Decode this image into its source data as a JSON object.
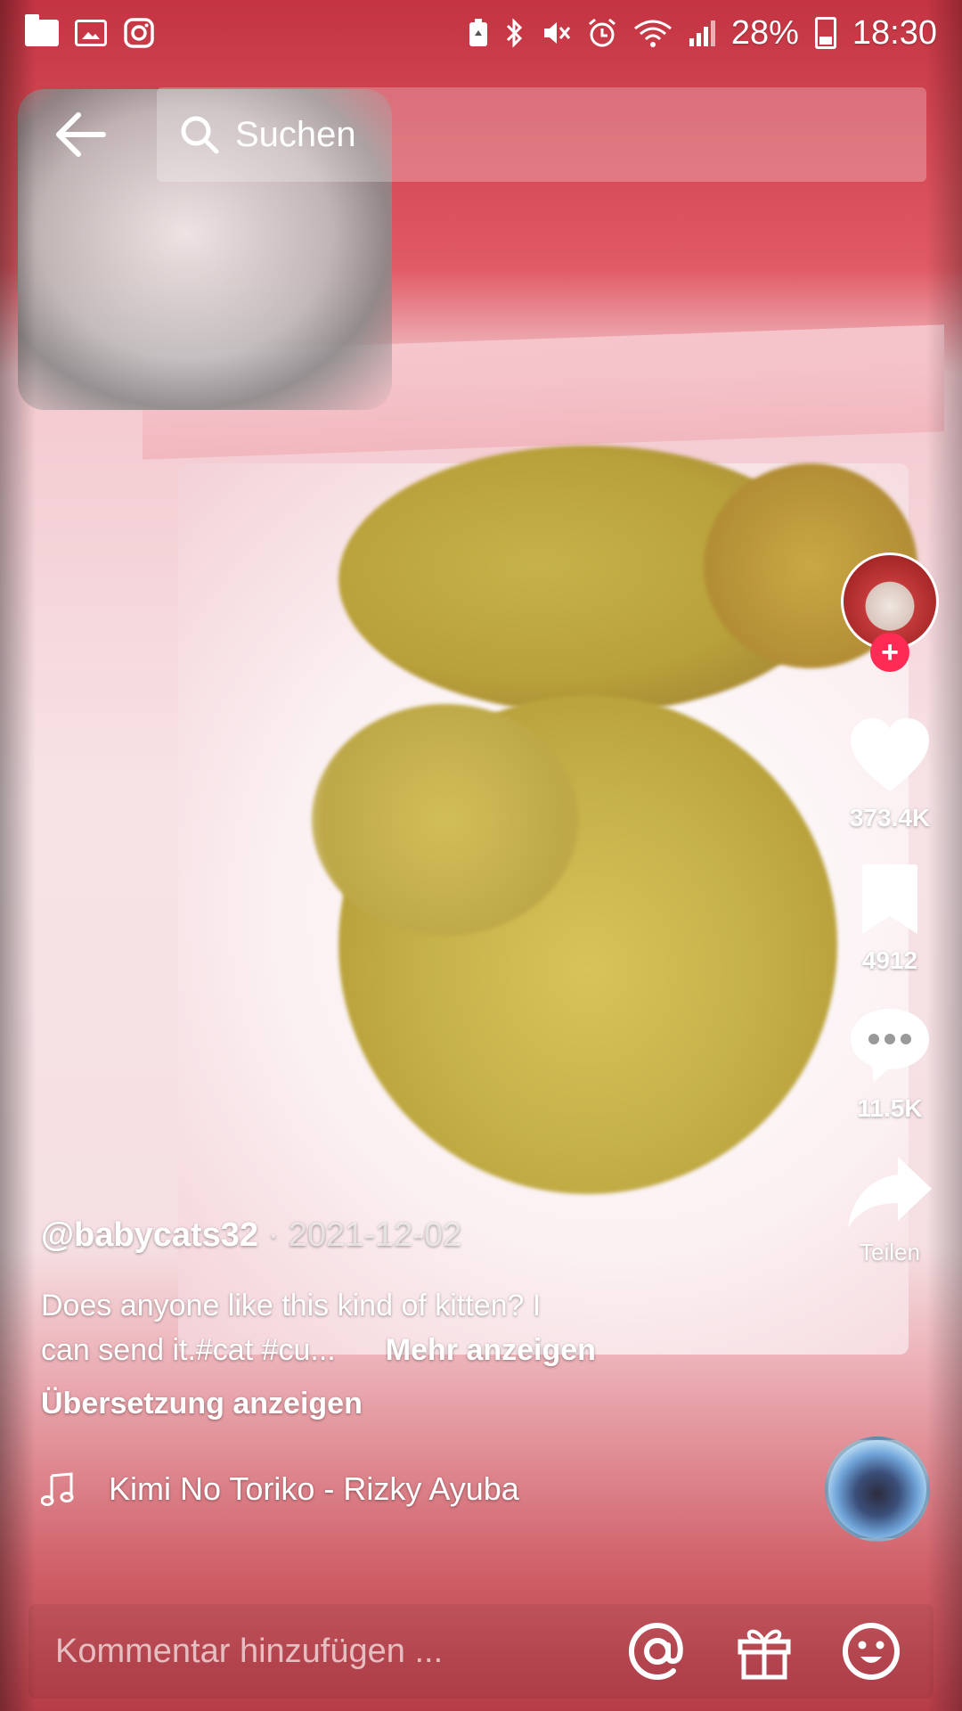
{
  "status_bar": {
    "battery": "28%",
    "time": "18:30",
    "left_icons": [
      "folder-icon",
      "gallery-icon",
      "instagram-icon"
    ],
    "right_icons": [
      "battery-saver-icon",
      "bluetooth-icon",
      "mute-icon",
      "alarm-icon",
      "wifi-icon",
      "signal-icon",
      "battery-icon"
    ]
  },
  "top_bar": {
    "back_icon": "arrow-left-icon",
    "search_icon": "search-icon",
    "search_label": "Suchen"
  },
  "actions": {
    "follow_icon": "plus-icon",
    "like_count": "373.4K",
    "save_count": "4912",
    "comment_count": "11.5K",
    "share_label": "Teilen"
  },
  "video": {
    "username": "@babycats32",
    "date": "2021-12-02",
    "description_line1": "Does anyone like this kind of kitten? I",
    "description_line2": "can send it.#cat #cu...",
    "more_label": "Mehr anzeigen",
    "translate_label": "Übersetzung anzeigen",
    "music_icon": "music-note-icon",
    "music_title": "Kimi No Toriko - Rizky Ayuba"
  },
  "comment_bar": {
    "placeholder": "Kommentar hinzufügen ...",
    "icons": [
      "at-icon",
      "gift-icon",
      "emoji-icon"
    ]
  },
  "colors": {
    "follow_badge": "#fe2c55"
  }
}
